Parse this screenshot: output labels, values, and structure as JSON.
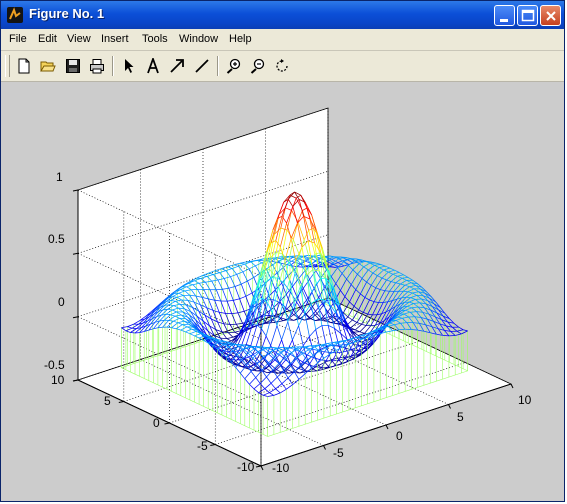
{
  "window": {
    "title": "Figure No. 1"
  },
  "menu": [
    "File",
    "Edit",
    "View",
    "Insert",
    "Tools",
    "Window",
    "Help"
  ],
  "toolbar": [
    "new-file-icon",
    "open-file-icon",
    "save-icon",
    "print-icon",
    "select-arrow-icon",
    "text-icon",
    "arrow-icon",
    "line-icon",
    "zoom-in-icon",
    "zoom-out-icon",
    "rotate-icon"
  ],
  "plot": {
    "z_ticks": [
      "1",
      "0.5",
      "0",
      "-0.5"
    ],
    "y_ticks": [
      "10",
      "5",
      "0",
      "-5",
      "-10"
    ],
    "x_ticks": [
      "-10",
      "-5",
      "0",
      "5",
      "10"
    ]
  },
  "chart_data": {
    "type": "mesh3d",
    "function": "sin(r)/r, r = sqrt(x^2+y^2)",
    "xlim": [
      -10,
      10
    ],
    "ylim": [
      -10,
      10
    ],
    "zlim": [
      -0.5,
      1
    ],
    "colormap": "jet",
    "meshz_skirt": true,
    "grid": true
  }
}
